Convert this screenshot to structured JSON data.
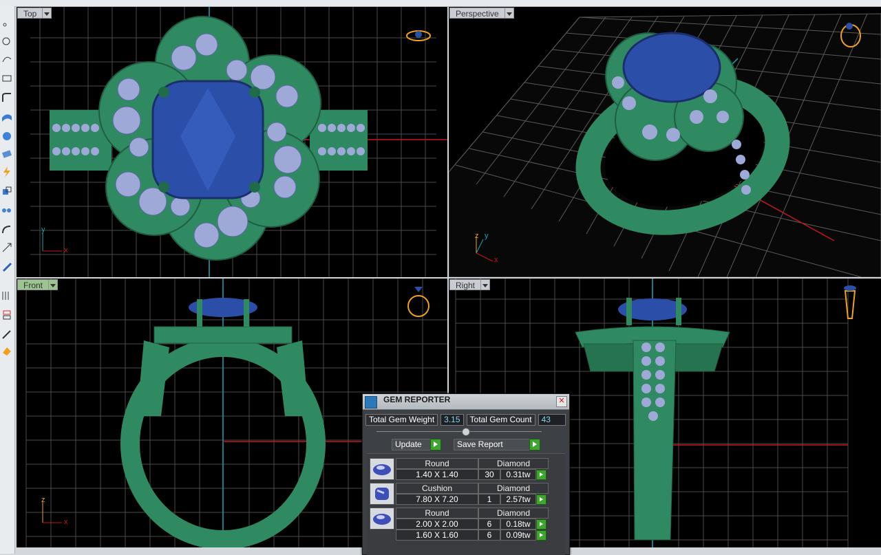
{
  "viewports": {
    "top": {
      "label": "Top",
      "axis_x": "x",
      "axis_y": "y"
    },
    "perspective": {
      "label": "Perspective",
      "axis_x": "x",
      "axis_y": "y",
      "axis_z": "z"
    },
    "front": {
      "label": "Front",
      "axis_x": "x",
      "axis_z": "z"
    },
    "right": {
      "label": "Right"
    }
  },
  "gem_reporter": {
    "title": "GEM REPORTER",
    "close_icon": "close-icon",
    "total_weight_label": "Total Gem Weight",
    "total_weight_value": "3.15",
    "total_count_label": "Total Gem Count",
    "total_count_value": "43",
    "update_label": "Update",
    "save_report_label": "Save Report",
    "groups": [
      {
        "shape": "Round",
        "material": "Diamond",
        "rows": [
          {
            "size": "1.40 X 1.40",
            "count": "30",
            "weight": "0.31tw"
          }
        ]
      },
      {
        "shape": "Cushion",
        "material": "Diamond",
        "rows": [
          {
            "size": "7.80 X 7.20",
            "count": "1",
            "weight": "2.57tw"
          }
        ]
      },
      {
        "shape": "Round",
        "material": "Diamond",
        "rows": [
          {
            "size": "2.00 X 2.00",
            "count": "6",
            "weight": "0.18tw"
          },
          {
            "size": "1.60 X 1.60",
            "count": "6",
            "weight": "0.09tw"
          }
        ]
      }
    ]
  },
  "colors": {
    "metal": "#2f8a62",
    "gem": "#2b4fa8",
    "diamond": "#9ea9d8",
    "grid": "#4a4a4a",
    "x_axis": "#c8161c",
    "y_axis": "#18a6b5"
  }
}
